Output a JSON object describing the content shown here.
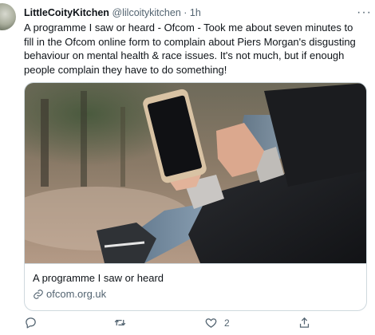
{
  "tweet": {
    "display_name": "LittleCoityKitchen",
    "handle": "@lilcoitykitchen",
    "separator": "·",
    "time": "1h",
    "more_label": "···",
    "text": "A programme I saw or heard - Ofcom - Took me about seven minutes to fill in the Ofcom online form to complain about Piers Morgan's disgusting behaviour on mental health & race issues. It's not much, but if enough people complain they have to do something!"
  },
  "card": {
    "title": "A programme I saw or heard",
    "domain": "ofcom.org.uk",
    "image_icon": "hands-holding-phone-photo"
  },
  "actions": {
    "reply_icon": "reply-icon",
    "retweet_icon": "retweet-icon",
    "like_icon": "heart-icon",
    "like_count": "2",
    "share_icon": "share-icon"
  },
  "colors": {
    "text": "#0f1419",
    "muted": "#536471",
    "border": "#cfd9de"
  }
}
